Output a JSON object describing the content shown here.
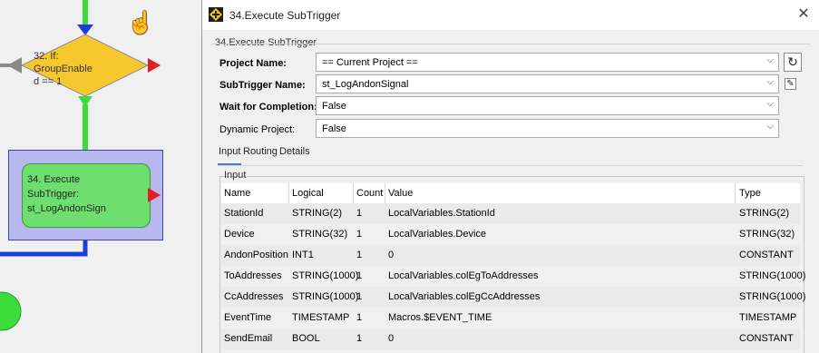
{
  "canvas": {
    "if_node_label": "32. If: GroupEnabled == 1",
    "if_node_lines": [
      "32. If:",
      "GroupEnable",
      "d == 1"
    ],
    "action_node_lines": [
      "34. Execute",
      "SubTrigger:",
      "st_LogAndonSign"
    ]
  },
  "dialog": {
    "title": "34.Execute SubTrigger",
    "close_glyph": "✕",
    "group_title": "34.Execute SubTrigger",
    "fields": {
      "project_name": {
        "label": "Project Name:",
        "value": "== Current Project =="
      },
      "subtrigger_name": {
        "label": "SubTrigger Name:",
        "value": "st_LogAndonSignal"
      },
      "wait_for_completion": {
        "label": "Wait for Completion:",
        "value": "False"
      },
      "dynamic_project": {
        "label": "Dynamic Project:",
        "value": "False"
      }
    },
    "refresh_glyph": "↻",
    "edit_glyph": "✎",
    "tabs": [
      {
        "label": "Input",
        "active": true
      },
      {
        "label": "Routing",
        "active": false
      },
      {
        "label": "Details",
        "active": false
      }
    ],
    "input_group_title": "Input",
    "table": {
      "columns": [
        "Name",
        "Logical",
        "Count",
        "Value",
        "Type"
      ],
      "rows": [
        [
          "StationId",
          "STRING(2)",
          "1",
          "LocalVariables.StationId",
          "STRING(2)"
        ],
        [
          "Device",
          "STRING(32)",
          "1",
          "LocalVariables.Device",
          "STRING(32)"
        ],
        [
          "AndonPosition",
          "INT1",
          "1",
          "0",
          "CONSTANT"
        ],
        [
          "ToAddresses",
          "STRING(1000)",
          "1",
          "LocalVariables.colEgToAddresses",
          "STRING(1000)"
        ],
        [
          "CcAddresses",
          "STRING(1000)",
          "1",
          "LocalVariables.colEgCcAddresses",
          "STRING(1000)"
        ],
        [
          "EventTime",
          "TIMESTAMP",
          "1",
          "Macros.$EVENT_TIME",
          "TIMESTAMP"
        ],
        [
          "SendEmail",
          "BOOL",
          "1",
          "0",
          "CONSTANT"
        ]
      ]
    }
  },
  "colors": {
    "flow_line": "#3cdc3c",
    "connector_blue": "#1a3fd6",
    "decision_fill": "#f7c72e",
    "action_fill": "#6ede6e",
    "selection_fill": "#b8b8ee",
    "red_arrow": "#e02020"
  }
}
